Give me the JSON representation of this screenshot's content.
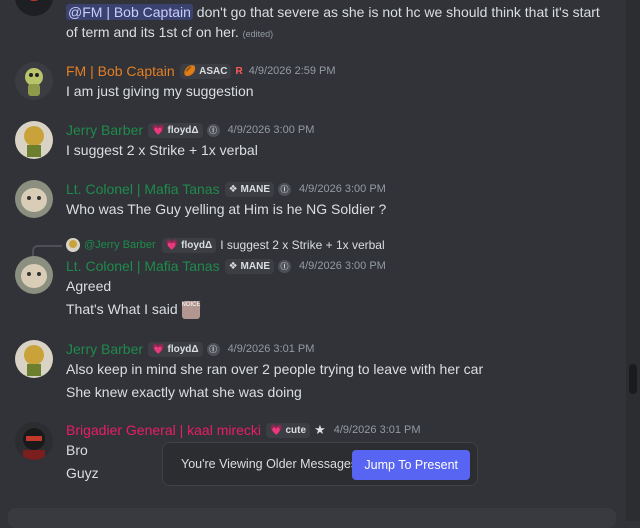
{
  "messages": [
    {
      "lines": [
        {
          "mention": "@FM | Bob Captain",
          "text": " don't go that severe as she is not hc we should think that it's start"
        },
        {
          "text": "of term and its 1st cf on her.",
          "edited": "(edited)"
        }
      ]
    },
    {
      "username": "FM | Bob Captain",
      "color": "#e67e22",
      "tag": "ASAC",
      "tag_icon": "🏉",
      "extra_badge": "R",
      "timestamp": "4/9/2026 2:59 PM",
      "lines": [
        "I am just giving my suggestion"
      ]
    },
    {
      "username": "Jerry Barber",
      "color": "#1f8b4c",
      "tag": "floydΔ",
      "tag_icon": "💗",
      "extra_badge": "Ⓘ",
      "timestamp": "4/9/2026 3:00 PM",
      "lines": [
        "I suggest 2 x Strike + 1x verbal"
      ]
    },
    {
      "username": "Lt. Colonel | Mafia Tanas",
      "color": "#1f8b4c",
      "tag": "MANE",
      "tag_icon": "❖",
      "extra_badge": "Ⓘ",
      "timestamp": "4/9/2026 3:00 PM",
      "lines": [
        "Who was The Guy yelling at Him is he NG Soldier ?"
      ]
    },
    {
      "reply": {
        "username": "@Jerry Barber",
        "tag": "floydΔ",
        "tag_icon": "💗",
        "text": "I suggest 2 x Strike + 1x verbal"
      },
      "username": "Lt. Colonel | Mafia Tanas",
      "color": "#1f8b4c",
      "tag": "MANE",
      "tag_icon": "❖",
      "extra_badge": "Ⓘ",
      "timestamp": "4/9/2026 3:00 PM",
      "lines": [
        "Agreed",
        "That's What I said"
      ],
      "sticker_label": "NOICE"
    },
    {
      "username": "Jerry Barber",
      "color": "#1f8b4c",
      "tag": "floydΔ",
      "tag_icon": "💗",
      "extra_badge": "Ⓘ",
      "timestamp": "4/9/2026 3:01 PM",
      "lines": [
        "Also keep in mind she ran over 2 people trying to leave with her car",
        "She knew exactly what she was doing"
      ]
    },
    {
      "username": "Brigadier General | kaal mirecki",
      "color": "#e91e63",
      "tag": "cute",
      "tag_icon": "💗",
      "extra_badge": "★",
      "timestamp": "4/9/2026 3:01 PM",
      "lines": [
        "Bro",
        "Guyz"
      ]
    }
  ],
  "jump_bar": {
    "text": "You're Viewing Older Messages",
    "button": "Jump To Present"
  },
  "colors": {
    "accent": "#5865f2",
    "background": "#313338"
  }
}
